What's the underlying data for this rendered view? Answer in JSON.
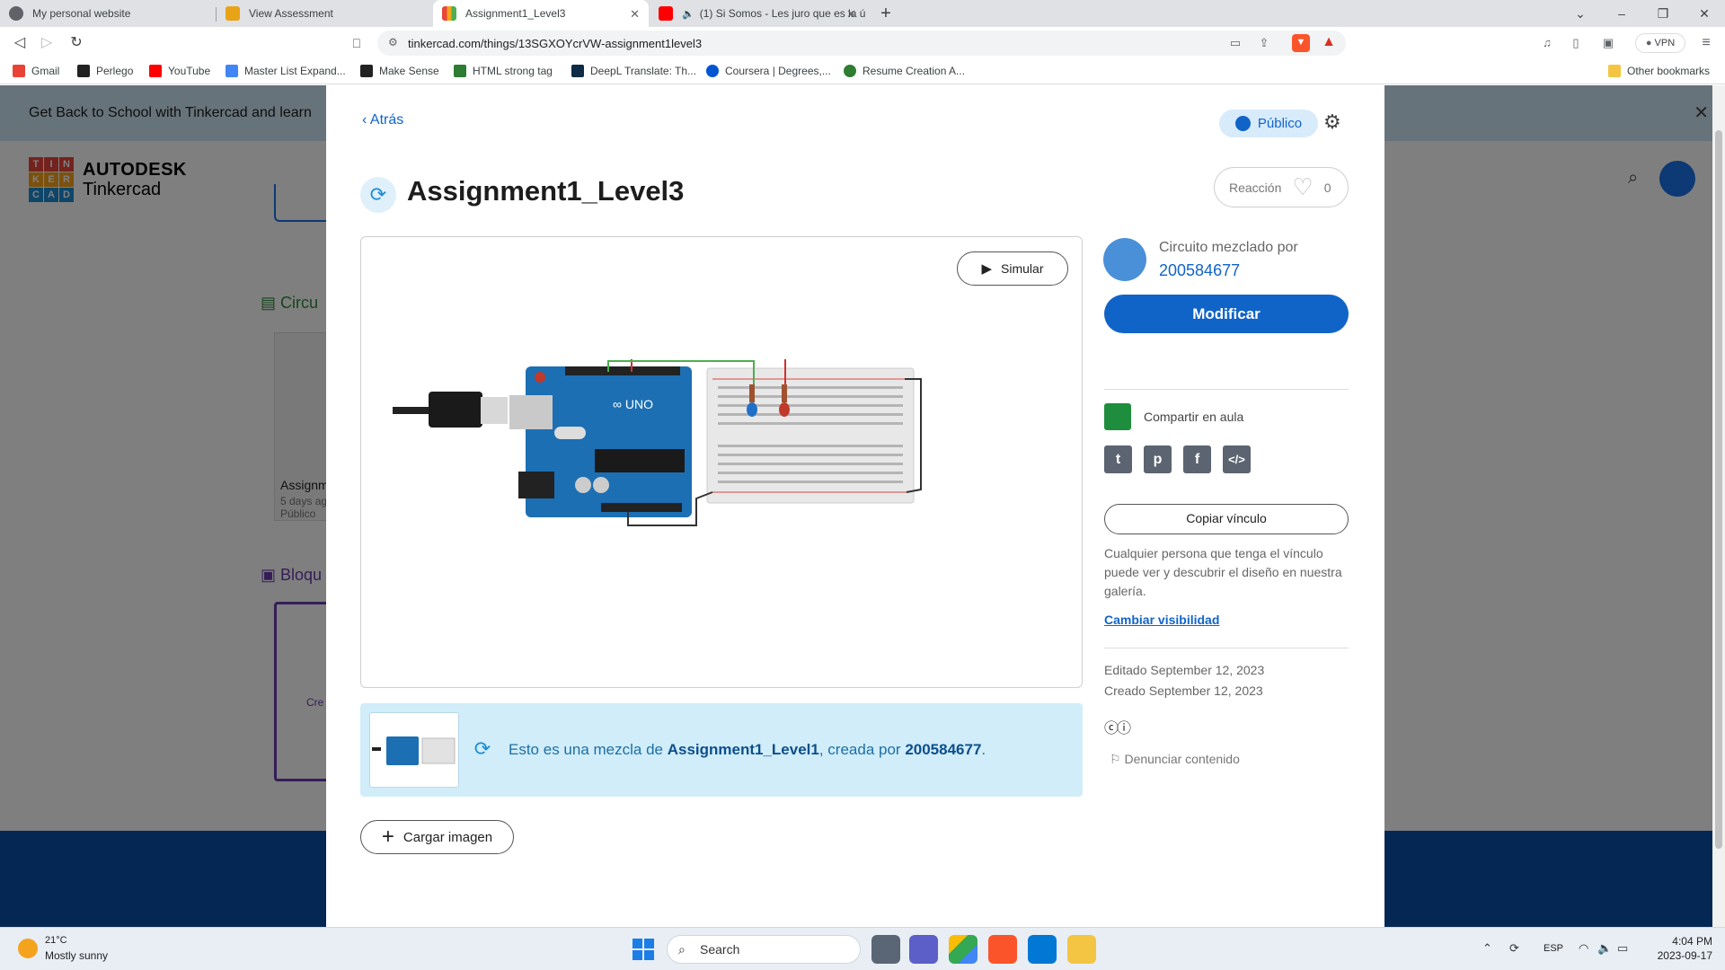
{
  "browser": {
    "tabs": [
      {
        "title": "My personal website",
        "favicon_color": "#5f6368"
      },
      {
        "title": "View Assessment",
        "favicon_color": "#e8a317"
      },
      {
        "title": "Assignment1_Level3",
        "favicon_color": "#e8453c"
      },
      {
        "title": "(1) Si Somos - Les juro que es la ú",
        "favicon_color": "#ff0000"
      }
    ],
    "url": "tinkercad.com/things/13SGXOYcrVW-assignment1level3",
    "vpn_label": "VPN",
    "bookmarks": [
      {
        "label": "Gmail",
        "color": "#ea4335"
      },
      {
        "label": "Perlego",
        "color": "#222222"
      },
      {
        "label": "YouTube",
        "color": "#ff0000"
      },
      {
        "label": "Master List Expand...",
        "color": "#4285f4"
      },
      {
        "label": "Make Sense",
        "color": "#222222"
      },
      {
        "label": "HTML strong tag",
        "color": "#2e7d32"
      },
      {
        "label": "DeepL Translate: Th...",
        "color": "#0f2b46"
      },
      {
        "label": "Coursera | Degrees,...",
        "color": "#0056d2"
      },
      {
        "label": "Resume Creation A...",
        "color": "#2e7d32"
      }
    ],
    "other_bookmarks": "Other bookmarks"
  },
  "background_page": {
    "banner": "Get Back to School with Tinkercad and learn",
    "logo_letters": [
      "T",
      "I",
      "N",
      "K",
      "E",
      "R",
      "C",
      "A",
      "D"
    ],
    "logo_brand": "AUTODESK",
    "logo_product": "Tinkercad",
    "section_circuits": "Circu",
    "section_blocks": "Bloqu",
    "card_title": "Assignm",
    "card_sub": "5 days ag",
    "card_visibility": "Público",
    "card2_text": "Cre"
  },
  "modal": {
    "back_label": "Atrás",
    "visibility_label": "Público",
    "title": "Assignment1_Level3",
    "reaction_label": "Reacción",
    "reaction_count": "0",
    "simulate_label": "Simular",
    "remix": {
      "prefix": "Esto es una mezcla de ",
      "source_name": "Assignment1_Level1",
      "middle": ", creada por ",
      "source_author": "200584677",
      "suffix": "."
    },
    "upload_label": "Cargar imagen",
    "author_label": "Circuito mezclado por",
    "author_name": "200584677",
    "modify_label": "Modificar",
    "classroom_label": "Compartir en aula",
    "share_icons": [
      "twitter-icon",
      "pinterest-icon",
      "facebook-icon",
      "embed-icon"
    ],
    "copy_link_label": "Copiar vínculo",
    "copy_help": "Cualquier persona que tenga el vínculo puede ver y descubrir el diseño en nuestra galería.",
    "change_visibility_label": "Cambiar visibilidad",
    "edited": "Editado September 12, 2023",
    "created": "Creado September 12, 2023",
    "report_label": "Denunciar contenido",
    "accent_color": "#1164c7"
  },
  "taskbar": {
    "weather_temp": "21°C",
    "weather_desc": "Mostly sunny",
    "search_placeholder": "Search",
    "language": "ESP",
    "time": "4:04 PM",
    "date": "2023-09-17"
  }
}
